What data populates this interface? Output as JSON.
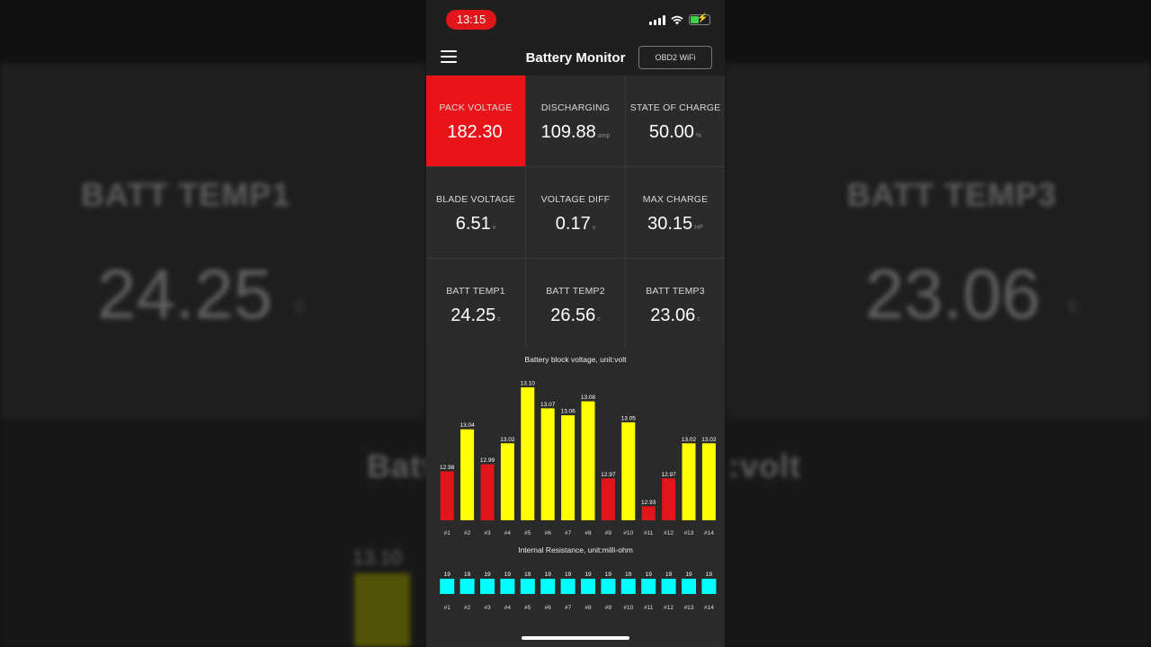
{
  "app": {
    "title": "Battery Monitor",
    "connection_button": "OBD2 WiFi"
  },
  "status_bar": {
    "time": "13:15",
    "time_color": "#e0161b"
  },
  "icons": {
    "menu": "hamburger-menu-icon",
    "signal": "cellular-signal-icon",
    "wifi": "wifi-icon",
    "battery": "battery-charging-icon"
  },
  "colors": {
    "active_tile": "#e8141a",
    "bar_high": "#ffff00",
    "bar_low": "#e0161b",
    "resistance": "#00ffff"
  },
  "tiles": [
    {
      "label": "PACK VOLTAGE",
      "value": "182.30",
      "unit": "",
      "active": true
    },
    {
      "label": "DISCHARGING",
      "value": "109.88",
      "unit": "amp",
      "active": false
    },
    {
      "label": "STATE OF CHARGE",
      "value": "50.00",
      "unit": "%",
      "active": false
    },
    {
      "label": "BLADE VOLTAGE",
      "value": "6.51",
      "unit": "v",
      "active": false
    },
    {
      "label": "VOLTAGE DIFF",
      "value": "0.17",
      "unit": "v",
      "active": false
    },
    {
      "label": "MAX CHARGE",
      "value": "30.15",
      "unit": "HP",
      "active": false
    },
    {
      "label": "BATT TEMP1",
      "value": "24.25",
      "unit": "c",
      "active": false
    },
    {
      "label": "BATT TEMP2",
      "value": "26.56",
      "unit": "c",
      "active": false
    },
    {
      "label": "BATT TEMP3",
      "value": "23.06",
      "unit": "c",
      "active": false
    }
  ],
  "background": {
    "left_label": "BATT TEMP1",
    "left_value": "24.25",
    "left_unit": "c",
    "right_label": "BATT TEMP3",
    "right_value": "23.06",
    "right_unit": "c",
    "bottom_text_left": "Batt",
    "bottom_text_right": ":volt",
    "bottom_bar_label": "13.10"
  },
  "chart_data": [
    {
      "type": "bar",
      "title": "Battery block voltage, unit:volt",
      "categories": [
        "#1",
        "#2",
        "#3",
        "#4",
        "#5",
        "#6",
        "#7",
        "#8",
        "#9",
        "#10",
        "#11",
        "#12",
        "#13",
        "#14"
      ],
      "values": [
        12.98,
        13.04,
        12.99,
        13.02,
        13.1,
        13.07,
        13.06,
        13.08,
        12.97,
        13.05,
        12.93,
        12.97,
        13.02,
        13.02
      ],
      "value_labels": [
        "12.98",
        "13.04",
        "12.99",
        "13.02",
        "13.10",
        "13.07",
        "13.06",
        "13.08",
        "12.97",
        "13.05",
        "12.93",
        "12.97",
        "13.02",
        "13.02"
      ],
      "colors": [
        "red",
        "yellow",
        "red",
        "yellow",
        "yellow",
        "yellow",
        "yellow",
        "yellow",
        "red",
        "yellow",
        "red",
        "red",
        "yellow",
        "yellow"
      ],
      "ylim": [
        12.91,
        13.1
      ]
    },
    {
      "type": "bar",
      "title": "Internal Resistance, unit:milli-ohm",
      "categories": [
        "#1",
        "#2",
        "#3",
        "#4",
        "#5",
        "#6",
        "#7",
        "#8",
        "#9",
        "#10",
        "#11",
        "#12",
        "#13",
        "#14"
      ],
      "values": [
        19,
        19,
        19,
        19,
        19,
        19,
        19,
        19,
        19,
        19,
        19,
        19,
        19,
        19
      ],
      "value_labels": [
        "19",
        "19",
        "19",
        "19",
        "19",
        "19",
        "19",
        "19",
        "19",
        "19",
        "19",
        "19",
        "19",
        "19"
      ]
    }
  ]
}
